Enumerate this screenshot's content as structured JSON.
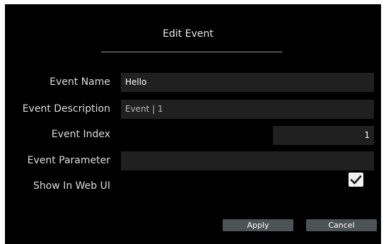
{
  "dialog": {
    "title": "Edit Event",
    "fields": {
      "event_name": {
        "label": "Event Name",
        "value": "Hello"
      },
      "event_description": {
        "label": "Event Description",
        "value": "Event | 1"
      },
      "event_index": {
        "label": "Event Index",
        "value": "1"
      },
      "event_parameter": {
        "label": "Event Parameter",
        "value": ""
      },
      "show_in_web_ui": {
        "label": "Show In Web UI",
        "checked": true
      }
    },
    "buttons": {
      "apply": "Apply",
      "cancel": "Cancel"
    }
  }
}
